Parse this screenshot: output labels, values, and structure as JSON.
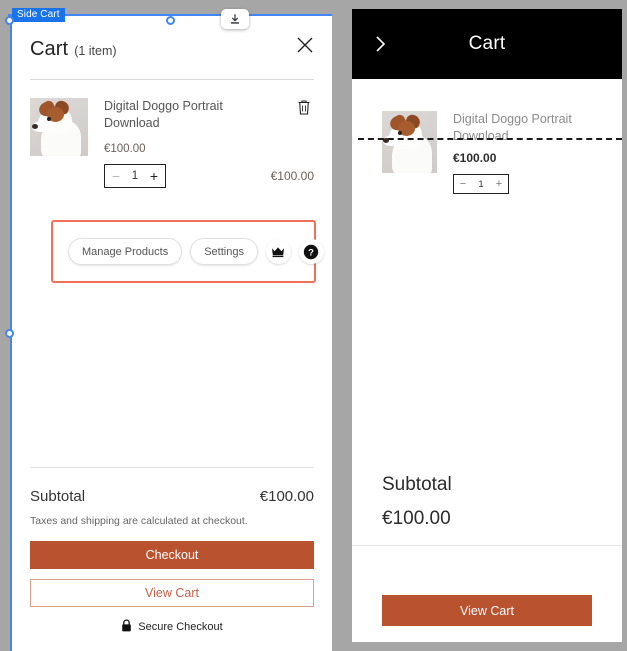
{
  "editor": {
    "selection_label": "Side Cart",
    "export_icon": "download-icon",
    "toolbar": {
      "manage_products_label": "Manage Products",
      "settings_label": "Settings",
      "upgrade_icon": "crown-icon",
      "help_icon": "help-circle-icon",
      "highlight_color": "#f0705a"
    }
  },
  "cart": {
    "title": "Cart",
    "count_label": "(1 item)",
    "close_icon": "close-icon",
    "items": [
      {
        "name": "Digital Doggo Portrait Download",
        "unit_price": "€100.00",
        "quantity": "1",
        "line_total": "€100.00",
        "minus_label": "−",
        "plus_label": "+",
        "remove_icon": "trash-icon",
        "thumbnail_alt": "dog-portrait-thumbnail"
      }
    ],
    "subtotal_label": "Subtotal",
    "subtotal_value": "€100.00",
    "tax_note": "Taxes and shipping are calculated at checkout.",
    "checkout_label": "Checkout",
    "view_cart_label": "View Cart",
    "secure_label": "Secure Checkout",
    "secure_icon": "lock-icon",
    "accent_color": "#b9522f"
  },
  "preview": {
    "back_icon": "chevron-right-icon",
    "title": "Cart",
    "header_bg": "#000000",
    "item": {
      "name": "Digital Doggo Portrait Download",
      "price": "€100.00",
      "quantity": "1",
      "minus_label": "−",
      "plus_label": "+",
      "thumbnail_alt": "dog-portrait-thumbnail"
    },
    "subtotal_label": "Subtotal",
    "subtotal_value": "€100.00",
    "view_cart_label": "View Cart",
    "accent_color": "#b9522f"
  }
}
